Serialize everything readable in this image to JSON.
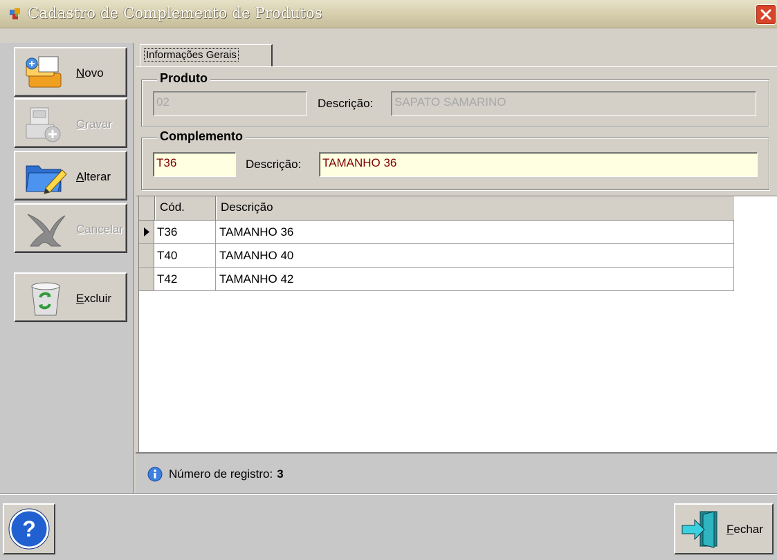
{
  "window": {
    "title": "Cadastro de Complemento de Produtos"
  },
  "sidebar": {
    "buttons": [
      {
        "mnemonic": "N",
        "rest": "ovo",
        "enabled": true,
        "icon": "new-record-icon"
      },
      {
        "mnemonic": "G",
        "rest": "ravar",
        "enabled": false,
        "icon": "save-disk-icon"
      },
      {
        "mnemonic": "A",
        "rest": "lterar",
        "enabled": true,
        "icon": "edit-folder-icon"
      },
      {
        "mnemonic": "C",
        "rest": "ancelar",
        "enabled": false,
        "icon": "cancel-x-icon"
      },
      {
        "mnemonic": "E",
        "rest": "xcluir",
        "enabled": true,
        "icon": "recycle-bin-icon"
      }
    ]
  },
  "tabs": [
    {
      "label": "Informações Gerais",
      "active": true
    }
  ],
  "produto": {
    "legend": "Produto",
    "code": "02",
    "desc_label": "Descrição:",
    "desc_value": "SAPATO SAMARINO"
  },
  "complemento": {
    "legend": "Complemento",
    "code": "T36",
    "desc_label": "Descrição:",
    "desc_value": "TAMANHO 36"
  },
  "grid": {
    "columns": [
      "Cód.",
      "Descrição"
    ],
    "rows": [
      {
        "cod": "T36",
        "desc": "TAMANHO 36",
        "current": true
      },
      {
        "cod": "T40",
        "desc": "TAMANHO 40",
        "current": false
      },
      {
        "cod": "T42",
        "desc": "TAMANHO 42",
        "current": false
      }
    ]
  },
  "status": {
    "label": "Número de registro:",
    "count": "3"
  },
  "footer": {
    "help": "?",
    "close_mnemonic": "F",
    "close_rest": "echar"
  },
  "colors": {
    "active_field_bg": "#ffffe1",
    "active_field_text": "#800000",
    "close_red": "#d8452a"
  }
}
